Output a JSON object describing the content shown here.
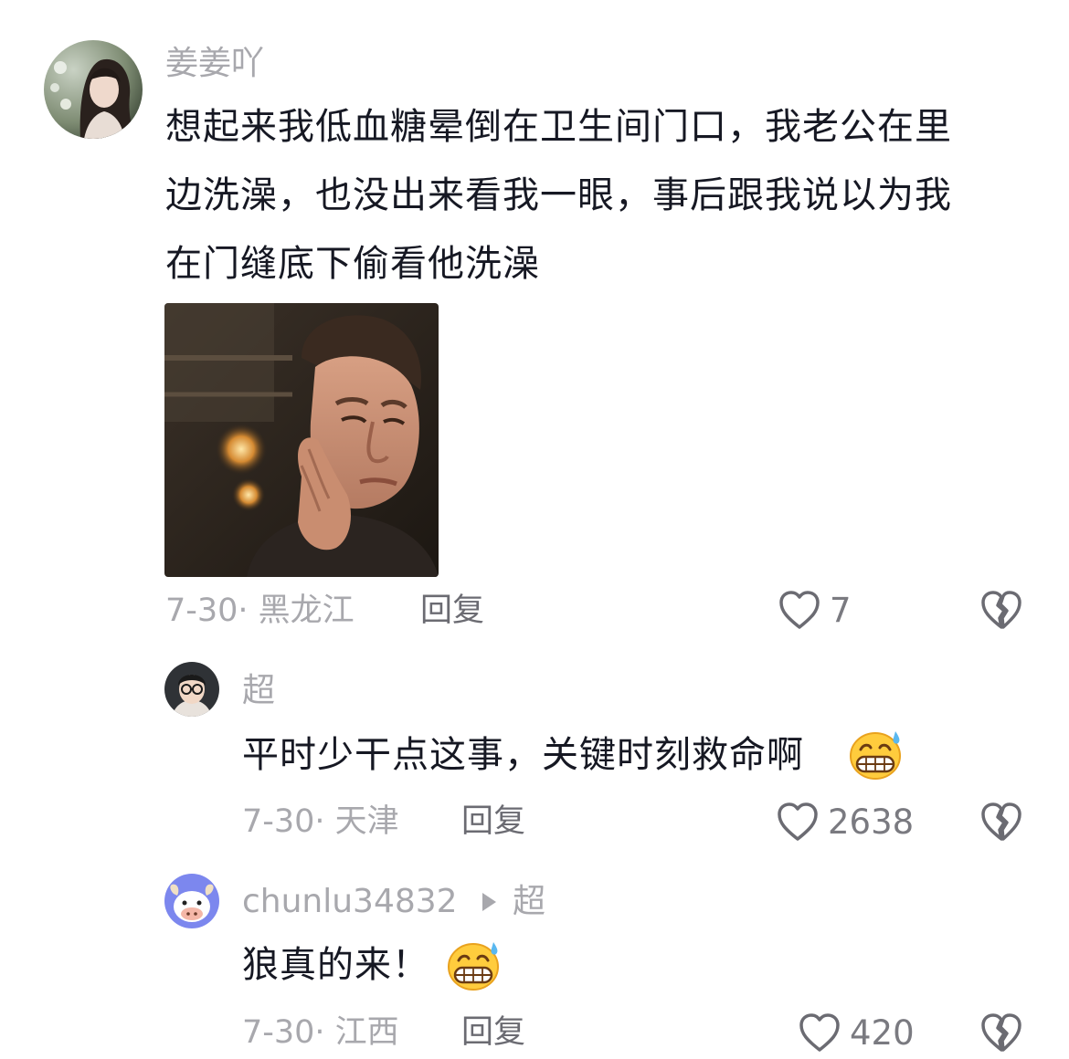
{
  "comments": [
    {
      "username": "姜姜吖",
      "text_lines": [
        "想起来我低血糖晕倒在卫生间门口，我老公在里",
        "边洗澡，也没出来看我一眼，事后跟我说以为我",
        "在门缝底下偷看他洗澡"
      ],
      "date_location": "7-30· 黑龙江",
      "reply_label": "回复",
      "like_count": "7",
      "has_image": true,
      "image_name": "gif-man-resting-face-on-hand"
    },
    {
      "username": "超",
      "text": "平时少干点这事，关键时刻救命啊",
      "emoji": "grimacing-sweat-emoji",
      "date_location": "7-30· 天津",
      "reply_label": "回复",
      "like_count": "2638"
    },
    {
      "username": "chunlu34832",
      "reply_to": "超",
      "text": "狼真的来！",
      "emoji": "grimacing-sweat-emoji",
      "date_location": "7-30· 江西",
      "reply_label": "回复",
      "like_count": "420"
    }
  ],
  "icons": {
    "like": "heart-outline-icon",
    "dislike": "broken-heart-icon"
  },
  "colors": {
    "text_primary": "#161823",
    "text_secondary": "#a8a8ad",
    "icon_gray": "#6b6b72"
  }
}
